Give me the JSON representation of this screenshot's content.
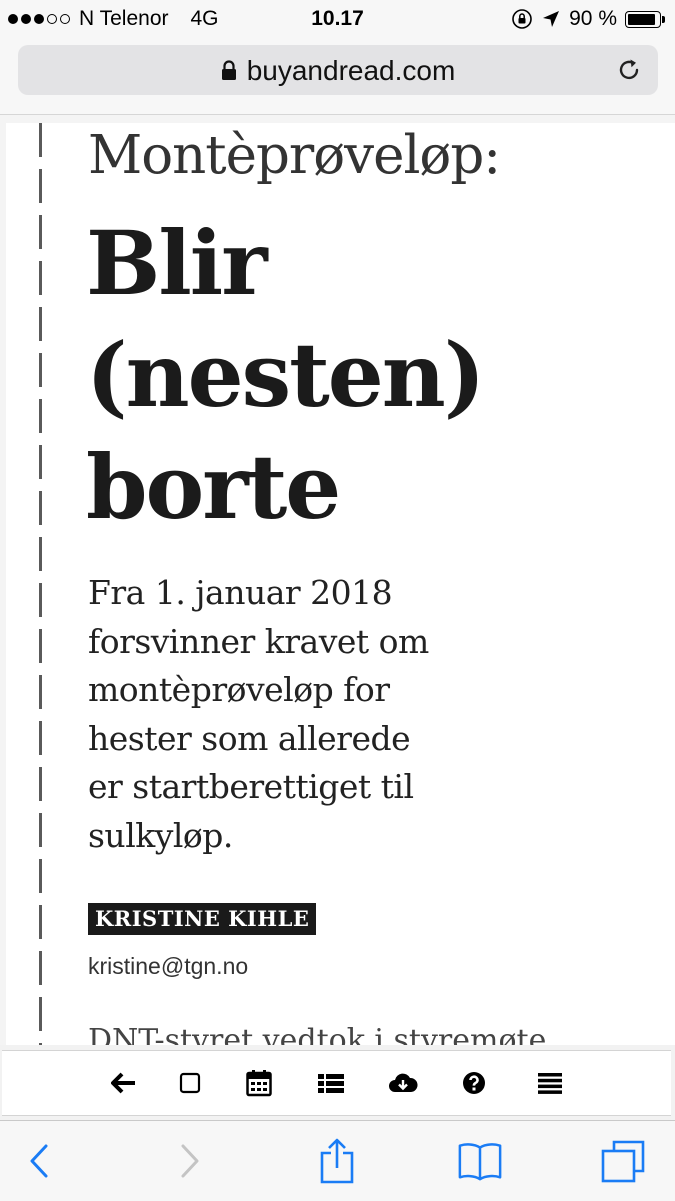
{
  "status_bar": {
    "carrier": "N Telenor",
    "network": "4G",
    "time": "10.17",
    "battery_percent": "90 %",
    "battery_level": 0.9,
    "signal_bars_filled": 3,
    "signal_bars_total": 5
  },
  "url_bar": {
    "domain": "buyandread.com"
  },
  "article": {
    "kicker": "Montèprøveløp:",
    "headline_lines": [
      "Blir",
      "(nesten)",
      "borte"
    ],
    "lead_lines": [
      "Fra 1. januar 2018",
      "forsvinner kravet om",
      "montèprøveløp for",
      "hester som allerede",
      "er startberettiget til",
      "sulkyløp."
    ],
    "byline": "KRISTINE KIHLE",
    "email": "kristine@tgn.no",
    "body_start": "DNT-styret vedtok i styremøte"
  },
  "site_toolbar": {
    "buttons": [
      "back-arrow-icon",
      "page-icon",
      "calendar-icon",
      "list-icon",
      "cloud-download-icon",
      "help-icon",
      "menu-icon"
    ]
  },
  "safari_toolbar": {
    "buttons": [
      "back-icon",
      "forward-icon",
      "share-icon",
      "bookmarks-icon",
      "tabs-icon"
    ],
    "accent": "#1a7cf5",
    "disabled": "#c4c4c4"
  }
}
